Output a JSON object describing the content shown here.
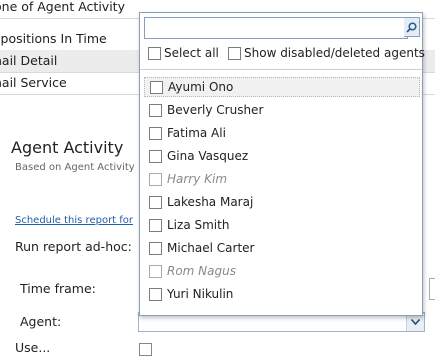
{
  "reports": [
    {
      "label": "one of Agent Activity"
    },
    {
      "label": "spositions In Time"
    },
    {
      "label": "nail Detail"
    },
    {
      "label": "nail Service"
    }
  ],
  "section": {
    "title": "Agent Activity",
    "subtitle": "Based on  Agent Activity",
    "schedule_link": "Schedule this report for",
    "adhoc_label": "Run report ad-hoc:"
  },
  "form": {
    "timeframe_label": "Time frame:",
    "agent_label": "Agent:",
    "next_label": "Use..."
  },
  "dropdown": {
    "search_value": "",
    "select_all_label": "Select all",
    "show_disabled_label": "Show disabled/deleted agents",
    "agents": [
      {
        "name": "Ayumi Ono",
        "checked": false,
        "disabled": false,
        "hover": true
      },
      {
        "name": "Beverly Crusher",
        "checked": false,
        "disabled": false
      },
      {
        "name": "Fatima Ali",
        "checked": false,
        "disabled": false
      },
      {
        "name": "Gina Vasquez",
        "checked": false,
        "disabled": false
      },
      {
        "name": "Harry Kim",
        "checked": false,
        "disabled": true
      },
      {
        "name": "Lakesha Maraj",
        "checked": false,
        "disabled": false
      },
      {
        "name": "Liza Smith",
        "checked": false,
        "disabled": false
      },
      {
        "name": "Michael Carter",
        "checked": false,
        "disabled": false
      },
      {
        "name": "Rom Nagus",
        "checked": false,
        "disabled": true
      },
      {
        "name": "Yuri Nikulin",
        "checked": false,
        "disabled": false
      }
    ]
  },
  "icons": {
    "search": "search-icon",
    "dropdown_arrow": "chevron-down-icon"
  },
  "colors": {
    "link": "#1f5fa8",
    "popup_border": "#8ba0b8",
    "disabled_text": "#8a8a8a"
  }
}
